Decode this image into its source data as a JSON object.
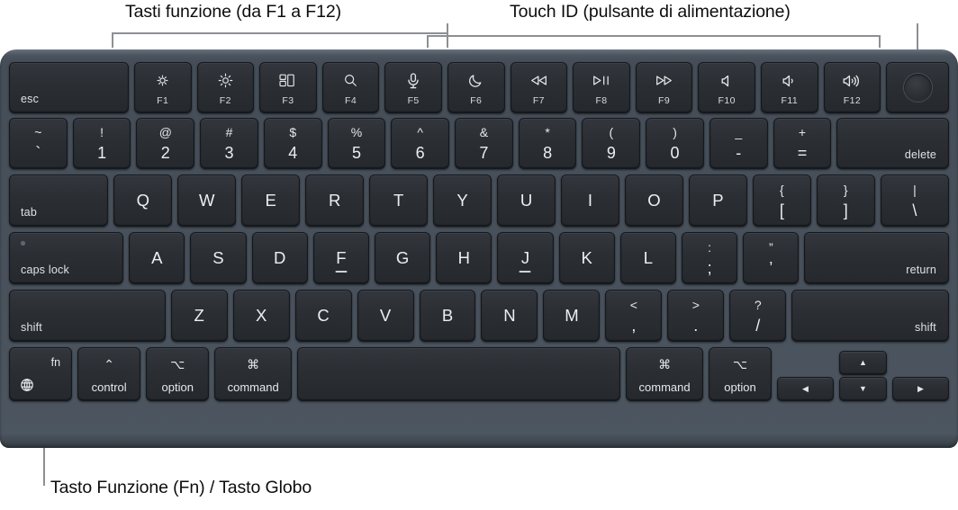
{
  "callouts": {
    "function_keys": "Tasti funzione (da F1 a F12)",
    "touch_id": "Touch ID (pulsante di alimentazione)",
    "fn_globe": "Tasto Funzione (Fn) / Tasto Globo"
  },
  "colors": {
    "page_background": "#ffffff",
    "chassis_top": "#6f7984",
    "chassis_body": "#49525c",
    "keycap_top": "#33373d",
    "keycap_bottom": "#25282d",
    "legend_text": "#eceff1",
    "leader_line": "#8c8f93"
  },
  "keyboard": {
    "layout": "US ANSI",
    "rows": {
      "function": [
        {
          "name": "esc",
          "label": "esc",
          "icon": null,
          "fnum": null
        },
        {
          "name": "f1",
          "label": null,
          "icon": "brightness-down-icon",
          "fnum": "F1"
        },
        {
          "name": "f2",
          "label": null,
          "icon": "brightness-up-icon",
          "fnum": "F2"
        },
        {
          "name": "f3",
          "label": null,
          "icon": "mission-control-icon",
          "fnum": "F3"
        },
        {
          "name": "f4",
          "label": null,
          "icon": "spotlight-search-icon",
          "fnum": "F4"
        },
        {
          "name": "f5",
          "label": null,
          "icon": "dictation-mic-icon",
          "fnum": "F5"
        },
        {
          "name": "f6",
          "label": null,
          "icon": "do-not-disturb-moon-icon",
          "fnum": "F6"
        },
        {
          "name": "f7",
          "label": null,
          "icon": "rewind-icon",
          "fnum": "F7"
        },
        {
          "name": "f8",
          "label": null,
          "icon": "play-pause-icon",
          "fnum": "F8"
        },
        {
          "name": "f9",
          "label": null,
          "icon": "fast-forward-icon",
          "fnum": "F9"
        },
        {
          "name": "f10",
          "label": null,
          "icon": "mute-icon",
          "fnum": "F10"
        },
        {
          "name": "f11",
          "label": null,
          "icon": "volume-down-icon",
          "fnum": "F11"
        },
        {
          "name": "f12",
          "label": null,
          "icon": "volume-up-icon",
          "fnum": "F12"
        },
        {
          "name": "touch-id",
          "label": null,
          "icon": "touch-id-power-icon",
          "fnum": null
        }
      ],
      "number": [
        {
          "name": "backtick",
          "top": "~",
          "bottom": "`"
        },
        {
          "name": "digit-1",
          "top": "!",
          "bottom": "1"
        },
        {
          "name": "digit-2",
          "top": "@",
          "bottom": "2"
        },
        {
          "name": "digit-3",
          "top": "#",
          "bottom": "3"
        },
        {
          "name": "digit-4",
          "top": "$",
          "bottom": "4"
        },
        {
          "name": "digit-5",
          "top": "%",
          "bottom": "5"
        },
        {
          "name": "digit-6",
          "top": "^",
          "bottom": "6"
        },
        {
          "name": "digit-7",
          "top": "&",
          "bottom": "7"
        },
        {
          "name": "digit-8",
          "top": "*",
          "bottom": "8"
        },
        {
          "name": "digit-9",
          "top": "(",
          "bottom": "9"
        },
        {
          "name": "digit-0",
          "top": ")",
          "bottom": "0"
        },
        {
          "name": "minus",
          "top": "_",
          "bottom": "-"
        },
        {
          "name": "equals",
          "top": "+",
          "bottom": "="
        },
        {
          "name": "delete",
          "label": "delete"
        }
      ],
      "top_letters": [
        {
          "name": "tab",
          "label": "tab"
        },
        {
          "name": "key-q",
          "letter": "Q"
        },
        {
          "name": "key-w",
          "letter": "W"
        },
        {
          "name": "key-e",
          "letter": "E"
        },
        {
          "name": "key-r",
          "letter": "R"
        },
        {
          "name": "key-t",
          "letter": "T"
        },
        {
          "name": "key-y",
          "letter": "Y"
        },
        {
          "name": "key-u",
          "letter": "U"
        },
        {
          "name": "key-i",
          "letter": "I"
        },
        {
          "name": "key-o",
          "letter": "O"
        },
        {
          "name": "key-p",
          "letter": "P"
        },
        {
          "name": "bracket-left",
          "top": "{",
          "bottom": "["
        },
        {
          "name": "bracket-right",
          "top": "}",
          "bottom": "]"
        },
        {
          "name": "backslash",
          "top": "|",
          "bottom": "\\"
        }
      ],
      "home_letters": [
        {
          "name": "caps-lock",
          "label": "caps lock"
        },
        {
          "name": "key-a",
          "letter": "A"
        },
        {
          "name": "key-s",
          "letter": "S"
        },
        {
          "name": "key-d",
          "letter": "D"
        },
        {
          "name": "key-f",
          "letter": "F",
          "homing": true
        },
        {
          "name": "key-g",
          "letter": "G"
        },
        {
          "name": "key-h",
          "letter": "H"
        },
        {
          "name": "key-j",
          "letter": "J",
          "homing": true
        },
        {
          "name": "key-k",
          "letter": "K"
        },
        {
          "name": "key-l",
          "letter": "L"
        },
        {
          "name": "semicolon",
          "top": ":",
          "bottom": ";"
        },
        {
          "name": "quote",
          "top": "”",
          "bottom": "’"
        },
        {
          "name": "return",
          "label": "return"
        }
      ],
      "bottom_letters": [
        {
          "name": "shift-left",
          "label": "shift"
        },
        {
          "name": "key-z",
          "letter": "Z"
        },
        {
          "name": "key-x",
          "letter": "X"
        },
        {
          "name": "key-c",
          "letter": "C"
        },
        {
          "name": "key-v",
          "letter": "V"
        },
        {
          "name": "key-b",
          "letter": "B"
        },
        {
          "name": "key-n",
          "letter": "N"
        },
        {
          "name": "key-m",
          "letter": "M"
        },
        {
          "name": "comma",
          "top": "<",
          "bottom": ","
        },
        {
          "name": "period",
          "top": ">",
          "bottom": "."
        },
        {
          "name": "slash",
          "top": "?",
          "bottom": "/"
        },
        {
          "name": "shift-right",
          "label": "shift"
        }
      ],
      "modifiers": [
        {
          "name": "fn-globe",
          "label": "fn",
          "icon": "globe-icon"
        },
        {
          "name": "control-left",
          "label": "control",
          "symbol": "⌃"
        },
        {
          "name": "option-left",
          "label": "option",
          "symbol": "⌥"
        },
        {
          "name": "command-left",
          "label": "command",
          "symbol": "⌘"
        },
        {
          "name": "space",
          "label": ""
        },
        {
          "name": "command-right",
          "label": "command",
          "symbol": "⌘"
        },
        {
          "name": "option-right",
          "label": "option",
          "symbol": "⌥"
        }
      ],
      "arrows": [
        {
          "name": "arrow-left",
          "glyph": "◀"
        },
        {
          "name": "arrow-up",
          "glyph": "▲"
        },
        {
          "name": "arrow-down",
          "glyph": "▼"
        },
        {
          "name": "arrow-right",
          "glyph": "▶"
        }
      ]
    }
  }
}
